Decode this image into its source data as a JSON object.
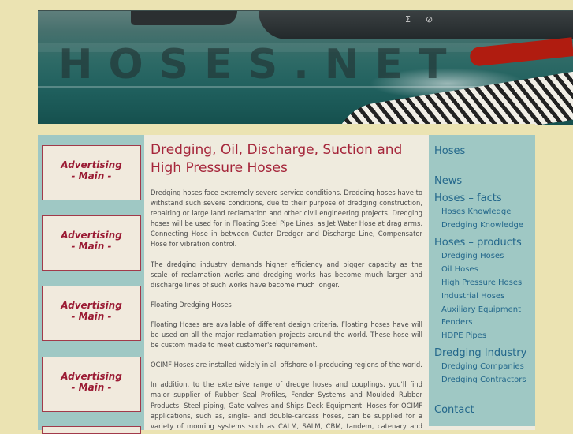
{
  "banner": {
    "title": "HOSES.NET",
    "ship_marks": [
      "Σ",
      "⊘"
    ]
  },
  "ads": [
    {
      "line1": "Advertising",
      "line2": "- Main -"
    },
    {
      "line1": "Advertising",
      "line2": "- Main -"
    },
    {
      "line1": "Advertising",
      "line2": "- Main -"
    },
    {
      "line1": "Advertising",
      "line2": "- Main -"
    }
  ],
  "article": {
    "title": "Dredging, Oil, Discharge, Suction and High Pressure Hoses",
    "paragraphs": [
      "Dredging hoses face extremely severe service conditions. Dredging hoses have to withstand such severe conditions, due to their purpose of dredging construction, repairing or large land reclamation and other civil engineering projects. Dredging hoses will be used for in Floating Steel Pipe Lines, as Jet Water Hose at drag arms, Connecting Hose in between Cutter Dredger and Discharge Line, Compensator Hose for vibration control.",
      "The dredging industry demands higher efficiency and bigger capacity as the scale of reclamation works and dredging works has become much larger and discharge lines of such works have become much longer.",
      "Floating Dredging Hoses",
      "Floating Hoses are available of different design criteria. Floating hoses have will be used on all the major reclamation projects around the world. These hose will be custom made to meet customer's requirement.",
      "OCIMF Hoses are installed widely in all offshore oil-producing regions of the world.",
      "In addition, to the extensive range of dredge hoses and couplings, you'll find major supplier of Rubber Seal Profiles, Fender Systems and Moulded Rubber Products. Steel piping, Gate valves and Ships Deck Equipment. Hoses for OCIMF applications, such as, single- and double-carcass hoses, can be supplied for a variety of mooring systems such as CALM, SALM, CBM, tandem, catenary and reeling applications."
    ]
  },
  "nav": {
    "hoses": "Hoses",
    "news": "News",
    "facts": {
      "label": "Hoses – facts",
      "items": [
        "Hoses Knowledge",
        "Dredging Knowledge"
      ]
    },
    "products": {
      "label": "Hoses – products",
      "items": [
        "Dredging Hoses",
        "Oil Hoses",
        "High Pressure Hoses",
        "Industrial Hoses",
        "Auxiliary Equipment",
        "Fenders",
        "HDPE Pipes"
      ]
    },
    "industry": {
      "label": "Dredging Industry",
      "items": [
        "Dredging Companies",
        "Dredging Contractors"
      ]
    },
    "contact": "Contact"
  }
}
